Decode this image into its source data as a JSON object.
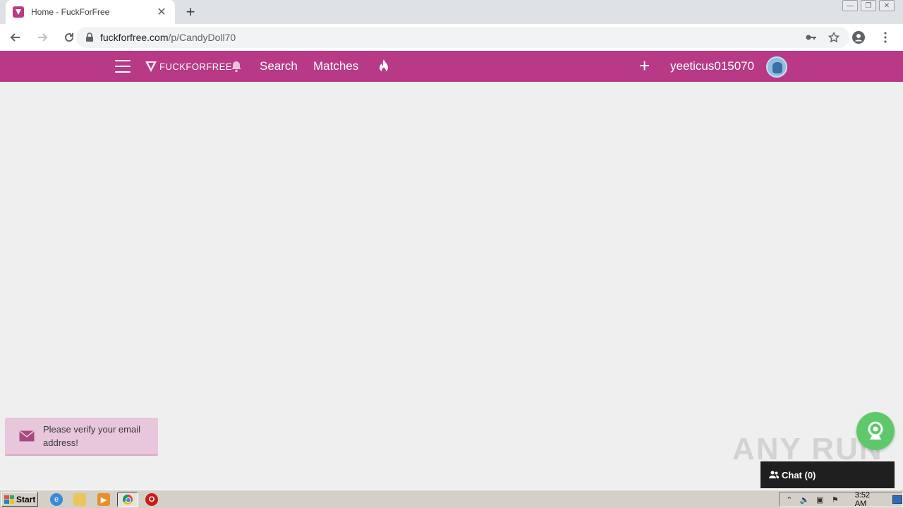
{
  "browser": {
    "tab_title": "Home - FuckForFree",
    "tab_close": "✕",
    "new_tab": "+",
    "url_host": "fuckforfree.com",
    "url_path": "/p/CandyDoll70",
    "window_controls": [
      "—",
      "❐",
      "✕"
    ]
  },
  "app": {
    "logo_text": "FUCKFORFREE",
    "nav": {
      "search_label": "Search",
      "matches_label": "Matches"
    },
    "add_label": "+",
    "username": "yeeticus015070",
    "accent_color": "#b83a86"
  },
  "toast": {
    "message": "Please verify your email address!"
  },
  "watermark": "ANY RUN",
  "chat": {
    "label": "Chat (0)"
  },
  "taskbar": {
    "start_label": "Start",
    "clock": "3:52 AM",
    "opera_glyph": "O"
  }
}
